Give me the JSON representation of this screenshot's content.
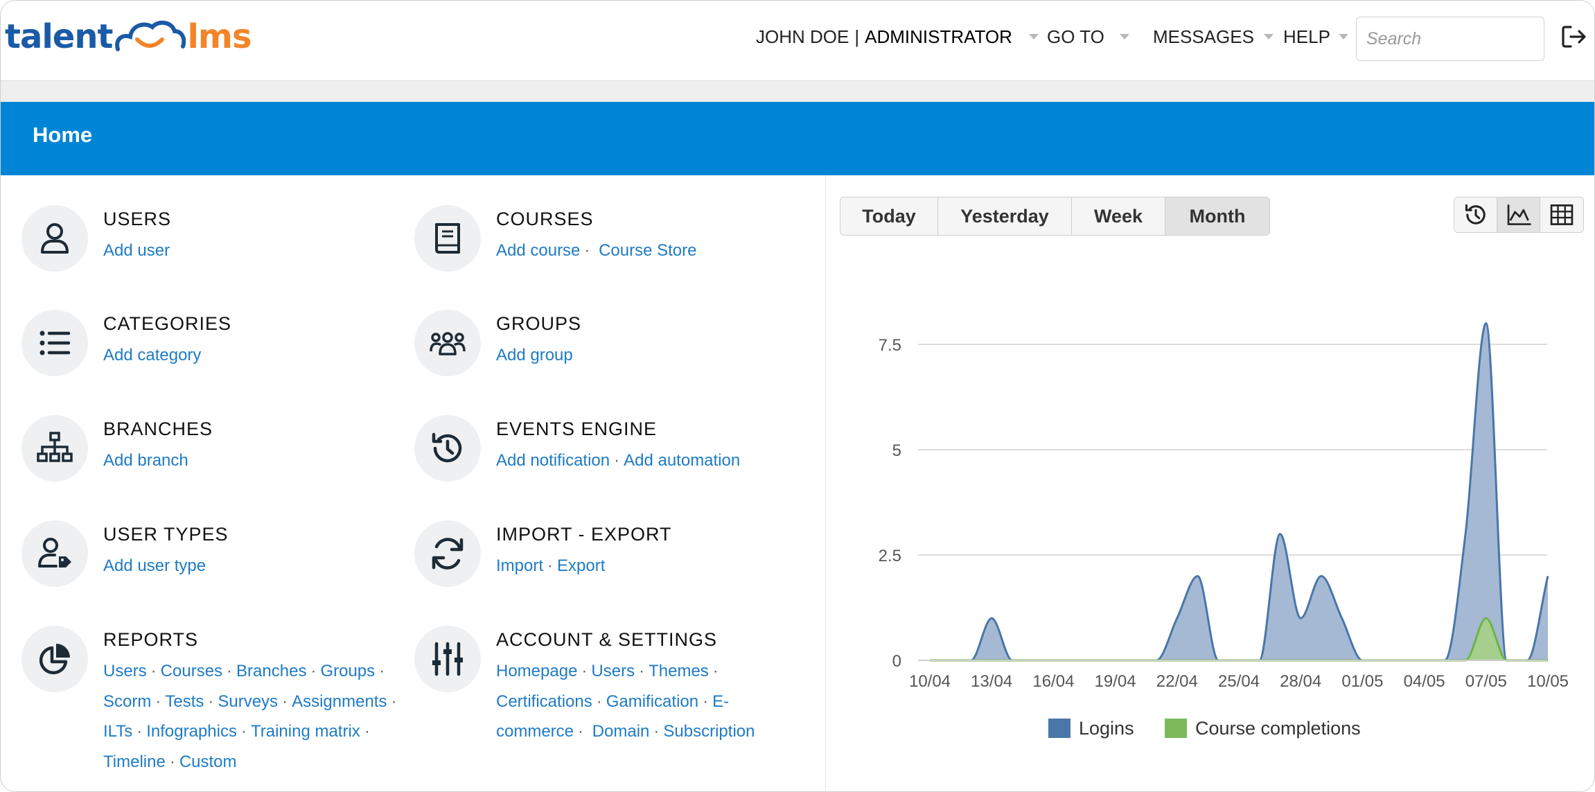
{
  "brand": {
    "part1": "talent",
    "part2": "lms"
  },
  "nav": {
    "user_name": "JOHN DOE",
    "separator": "|",
    "role": "ADMINISTRATOR",
    "goto": "GO TO",
    "messages": "MESSAGES",
    "help": "HELP",
    "search_placeholder": "Search"
  },
  "page_title": "Home",
  "sections": {
    "users": {
      "title": "USERS",
      "links": [
        "Add user"
      ]
    },
    "courses": {
      "title": "COURSES",
      "links": [
        "Add course",
        "Course Store"
      ]
    },
    "categories": {
      "title": "CATEGORIES",
      "links": [
        "Add category"
      ]
    },
    "groups": {
      "title": "GROUPS",
      "links": [
        "Add group"
      ]
    },
    "branches": {
      "title": "BRANCHES",
      "links": [
        "Add branch"
      ]
    },
    "events": {
      "title": "EVENTS ENGINE",
      "links": [
        "Add notification",
        "Add automation"
      ]
    },
    "user_types": {
      "title": "USER TYPES",
      "links": [
        "Add user type"
      ]
    },
    "import_export": {
      "title": "IMPORT - EXPORT",
      "links": [
        "Import",
        "Export"
      ]
    },
    "reports": {
      "title": "REPORTS",
      "links": [
        "Users",
        "Courses",
        "Branches",
        "Groups",
        "Scorm",
        "Tests",
        "Surveys",
        "Assignments",
        "ILTs",
        "Infographics",
        "Training matrix",
        "Timeline",
        "Custom"
      ]
    },
    "account": {
      "title": "ACCOUNT & SETTINGS",
      "links": [
        "Homepage",
        "Users",
        "Themes",
        "Certifications",
        "Gamification",
        "E-commerce",
        "Domain",
        "Subscription"
      ]
    }
  },
  "period_tabs": [
    "Today",
    "Yesterday",
    "Week",
    "Month"
  ],
  "active_period": "Month",
  "view_icons": [
    "history-icon",
    "area-chart-icon",
    "table-icon"
  ],
  "colors": {
    "accent": "#0085d6",
    "link": "#1f7bc5",
    "logins": "#4a76a8",
    "logins_fill": "#a0b5d3",
    "completions": "#7cba5c"
  },
  "chart_data": {
    "type": "area",
    "x": [
      "10/04",
      "11/04",
      "12/04",
      "13/04",
      "14/04",
      "15/04",
      "16/04",
      "17/04",
      "18/04",
      "19/04",
      "20/04",
      "21/04",
      "22/04",
      "23/04",
      "24/04",
      "25/04",
      "26/04",
      "27/04",
      "28/04",
      "29/04",
      "30/04",
      "01/05",
      "02/05",
      "03/05",
      "04/05",
      "05/05",
      "06/05",
      "07/05",
      "08/05",
      "09/05",
      "10/05"
    ],
    "tick_labels": [
      "10/04",
      "13/04",
      "16/04",
      "19/04",
      "22/04",
      "25/04",
      "28/04",
      "01/05",
      "04/05",
      "07/05",
      "10/05"
    ],
    "series": [
      {
        "name": "Logins",
        "values": [
          0,
          0,
          0,
          1,
          0,
          0,
          0,
          0,
          0,
          0,
          0,
          0,
          1,
          2,
          0,
          0,
          0,
          3,
          1,
          2,
          1,
          0,
          0,
          0,
          0,
          0,
          3,
          8,
          0,
          0,
          2
        ]
      },
      {
        "name": "Course completions",
        "values": [
          0,
          0,
          0,
          0,
          0,
          0,
          0,
          0,
          0,
          0,
          0,
          0,
          0,
          0,
          0,
          0,
          0,
          0,
          0,
          0,
          0,
          0,
          0,
          0,
          0,
          0,
          0,
          1,
          0,
          0,
          0
        ]
      }
    ],
    "yticks": [
      "0",
      "2.5",
      "5",
      "7.5"
    ],
    "ylim": [
      0,
      8
    ],
    "grid": true,
    "legend": "bottom"
  }
}
